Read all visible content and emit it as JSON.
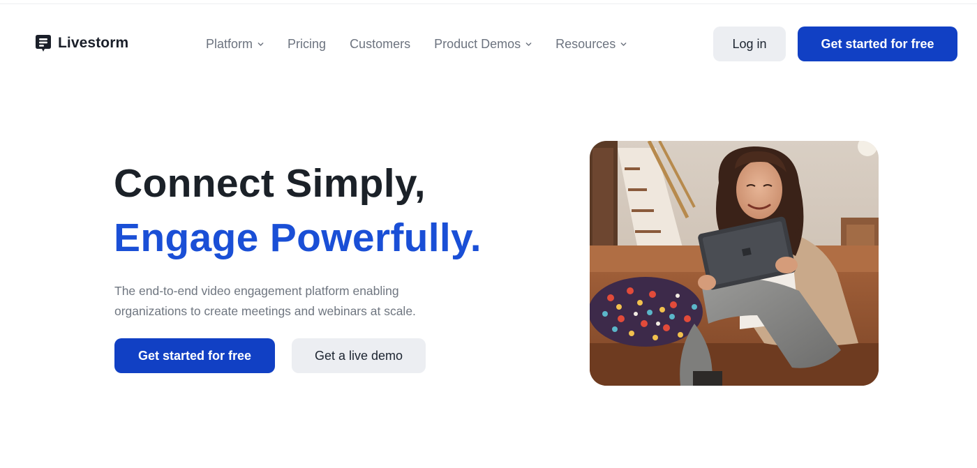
{
  "brand": {
    "name": "Livestorm",
    "logo_icon": "livestorm-logo-icon",
    "color_primary": "#1140c4",
    "color_accent_text": "#1a4fd6"
  },
  "nav": {
    "items": [
      {
        "label": "Platform",
        "has_dropdown": true,
        "icon": "chevron-down-icon"
      },
      {
        "label": "Pricing",
        "has_dropdown": false
      },
      {
        "label": "Customers",
        "has_dropdown": false
      },
      {
        "label": "Product Demos",
        "has_dropdown": true,
        "icon": "chevron-down-icon"
      },
      {
        "label": "Resources",
        "has_dropdown": true,
        "icon": "chevron-down-icon"
      }
    ],
    "login_label": "Log in",
    "cta_label": "Get started for free"
  },
  "hero": {
    "title_line1": "Connect Simply,",
    "title_line2": "Engage Powerfully.",
    "subtitle_line1": "The end-to-end video engagement platform enabling",
    "subtitle_line2": "organizations to create meetings and webinars at scale.",
    "primary_cta": "Get started for free",
    "secondary_cta": "Get a live demo",
    "image_subject": "woman-with-tablet-on-sofa"
  }
}
